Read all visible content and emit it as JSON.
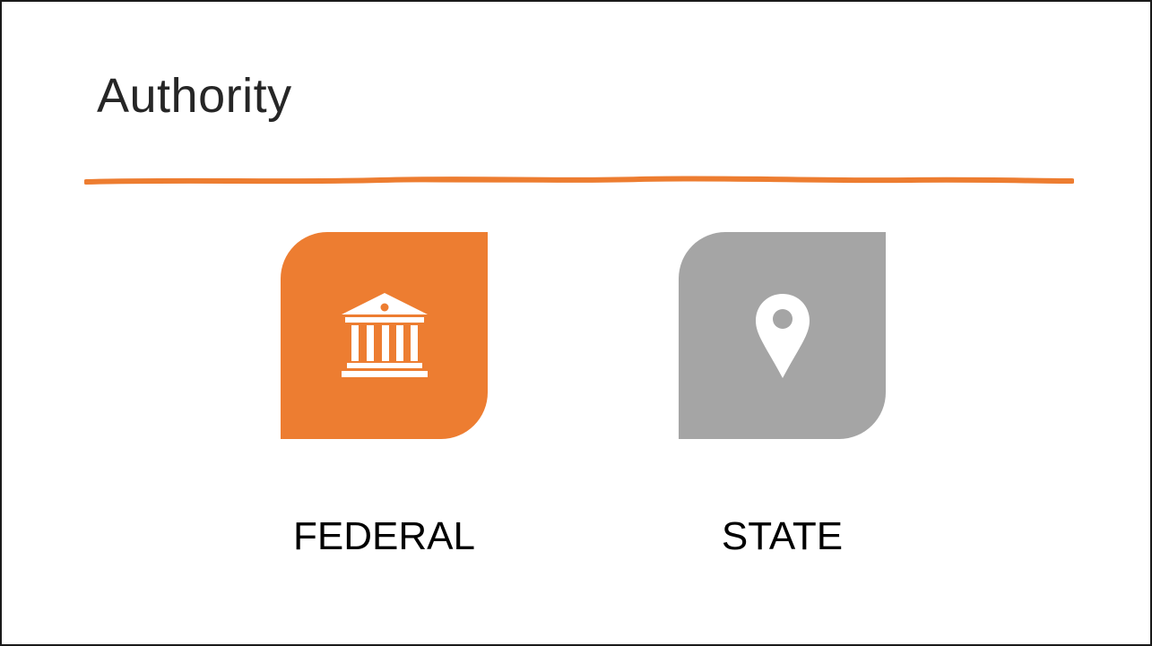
{
  "slide": {
    "title": "Authority",
    "accent_color": "#ED7D31"
  },
  "items": [
    {
      "label": "FEDERAL",
      "icon": "government-building-icon",
      "tile_color": "#ED7D31"
    },
    {
      "label": "STATE",
      "icon": "map-pin-icon",
      "tile_color": "#A5A5A5"
    }
  ]
}
